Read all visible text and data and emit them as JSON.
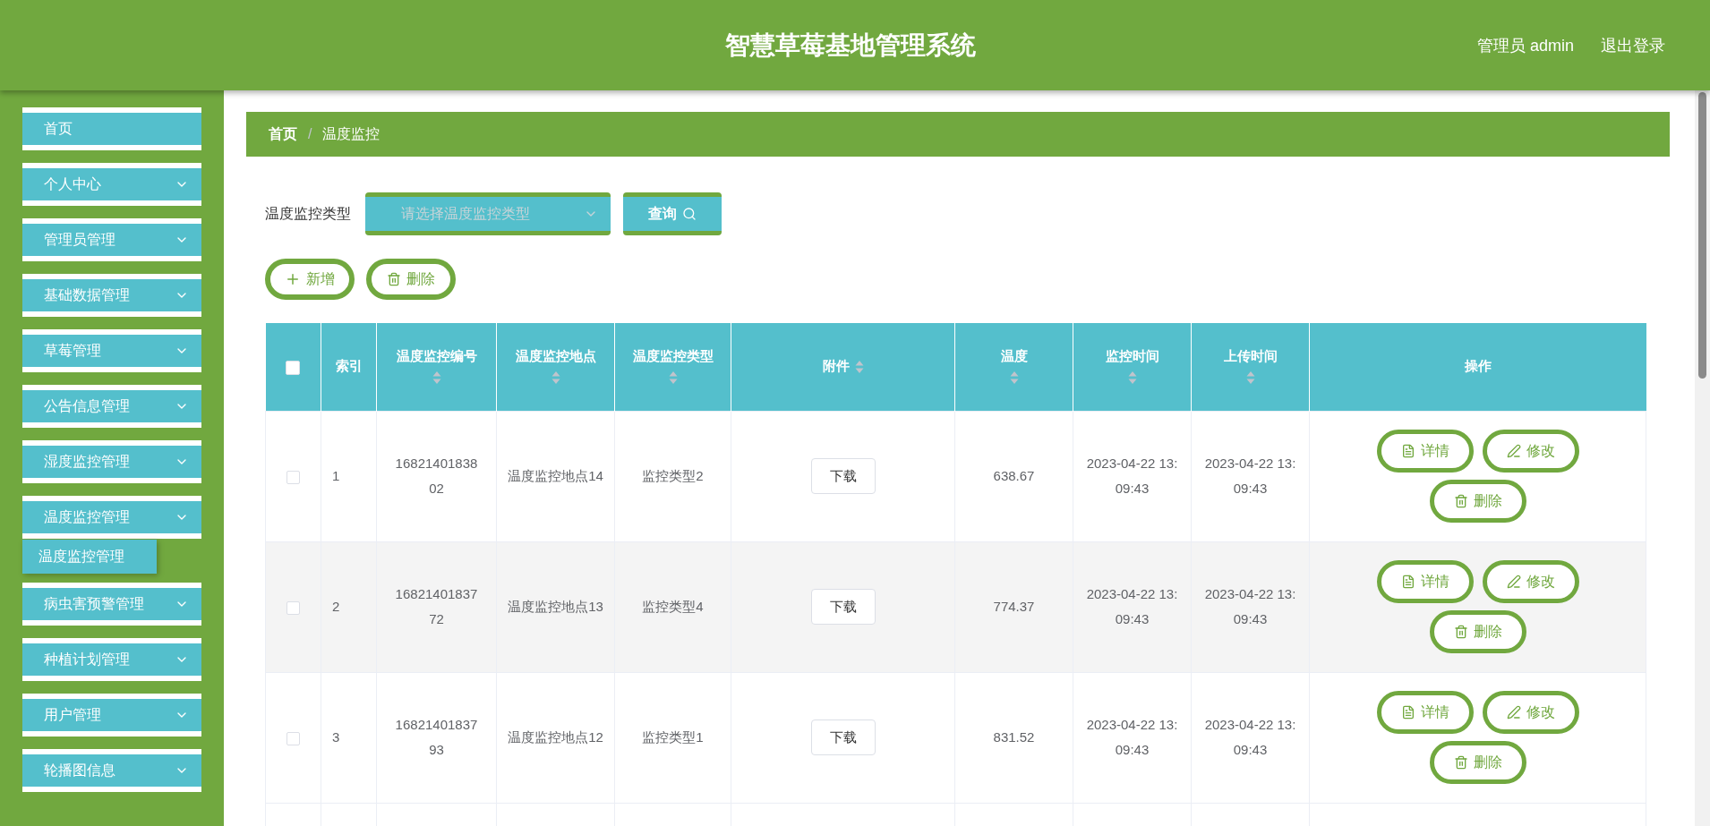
{
  "header": {
    "title": "智慧草莓基地管理系统",
    "user": "管理员 admin",
    "logout": "退出登录"
  },
  "sidebar": {
    "items": [
      {
        "label": "首页",
        "kind": "link"
      },
      {
        "label": "个人中心",
        "kind": "menu"
      },
      {
        "label": "管理员管理",
        "kind": "menu"
      },
      {
        "label": "基础数据管理",
        "kind": "menu"
      },
      {
        "label": "草莓管理",
        "kind": "menu"
      },
      {
        "label": "公告信息管理",
        "kind": "menu"
      },
      {
        "label": "湿度监控管理",
        "kind": "menu"
      },
      {
        "label": "温度监控管理",
        "kind": "menu",
        "children": [
          {
            "label": "温度监控管理"
          }
        ]
      },
      {
        "label": "病虫害预警管理",
        "kind": "menu"
      },
      {
        "label": "种植计划管理",
        "kind": "menu"
      },
      {
        "label": "用户管理",
        "kind": "menu"
      },
      {
        "label": "轮播图信息",
        "kind": "menu"
      }
    ]
  },
  "breadcrumb": [
    {
      "label": "首页"
    },
    {
      "label": "温度监控"
    }
  ],
  "breadcrumb_separator": "/",
  "filter": {
    "label": "温度监控类型",
    "placeholder": "请选择温度监控类型",
    "query_button": "查询"
  },
  "toolbar": [
    {
      "label": "新增",
      "kind": "add"
    },
    {
      "label": "删除",
      "kind": "delete"
    }
  ],
  "table": {
    "select_all": {
      "checked": false
    },
    "columns": [
      {
        "label": "索引",
        "sortable": false
      },
      {
        "label": "温度监控编号",
        "sortable": true
      },
      {
        "label": "温度监控地点",
        "sortable": true
      },
      {
        "label": "温度监控类型",
        "sortable": true
      },
      {
        "label": "附件",
        "sortable": true
      },
      {
        "label": "温度",
        "sortable": true
      },
      {
        "label": "监控时间",
        "sortable": true
      },
      {
        "label": "上传时间",
        "sortable": true
      },
      {
        "label": "操作",
        "sortable": false
      }
    ],
    "rows": [
      {
        "checked": false,
        "index": "1",
        "code": "1682140183802",
        "location": "温度监控地点14",
        "type": "监控类型2",
        "attachment": "下载",
        "temperature": "638.67",
        "monitor_time": "2023-04-22 13:09:43",
        "upload_time": "2023-04-22 13:09:43",
        "actions": [
          {
            "label": "详情",
            "kind": "detail"
          },
          {
            "label": "修改",
            "kind": "edit"
          },
          {
            "label": "删除",
            "kind": "delete"
          }
        ]
      },
      {
        "checked": false,
        "index": "2",
        "code": "1682140183772",
        "location": "温度监控地点13",
        "type": "监控类型4",
        "attachment": "下载",
        "temperature": "774.37",
        "monitor_time": "2023-04-22 13:09:43",
        "upload_time": "2023-04-22 13:09:43",
        "actions": [
          {
            "label": "详情",
            "kind": "detail"
          },
          {
            "label": "修改",
            "kind": "edit"
          },
          {
            "label": "删除",
            "kind": "delete"
          }
        ]
      },
      {
        "checked": false,
        "index": "3",
        "code": "1682140183793",
        "location": "温度监控地点12",
        "type": "监控类型1",
        "attachment": "下载",
        "temperature": "831.52",
        "monitor_time": "2023-04-22 13:09:43",
        "upload_time": "2023-04-22 13:09:43",
        "actions": [
          {
            "label": "详情",
            "kind": "detail"
          },
          {
            "label": "修改",
            "kind": "edit"
          },
          {
            "label": "删除",
            "kind": "delete"
          }
        ]
      }
    ]
  }
}
